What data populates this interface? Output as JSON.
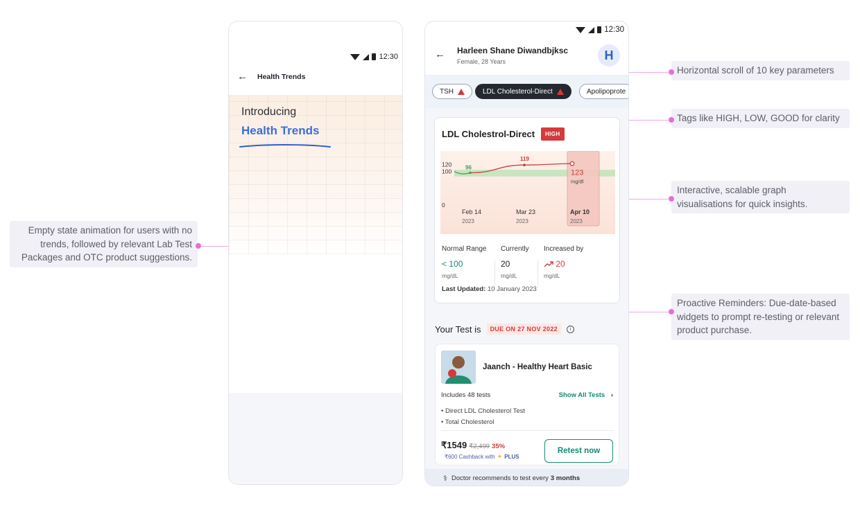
{
  "annotations": {
    "empty_state": "Empty state animation for users with no trends, followed by relevant Lab Test Packages and OTC product suggestions.",
    "horizontal_scroll": "Horizontal scroll of 10 key parameters",
    "tags": "Tags like HIGH, LOW, GOOD for clarity",
    "graph": "Interactive, scalable graph visualisations for quick insights.",
    "reminders": "Proactive Reminders: Due-date-based widgets to prompt re-testing or relevant product purchase."
  },
  "phone1": {
    "time": "12:30",
    "header_title": "Health Trends",
    "intro": "Introducing",
    "hero_title": "Health Trends"
  },
  "phone2": {
    "time": "12:30",
    "patient_name": "Harleen Shane Diwandbjksc",
    "patient_sub": "Female, 28 Years",
    "avatar_letter": "H",
    "chips": [
      "TSH",
      "LDL Cholesterol-Direct",
      "Apolipoprote"
    ],
    "card": {
      "title": "LDL Cholestrol-Direct",
      "badge": "HIGH",
      "normal_label": "Normal Range",
      "normal_value": "< 100",
      "normal_unit": "mg/dL",
      "current_label": "Currently",
      "current_value": "20",
      "current_unit": "mg/dL",
      "increase_label": "Increased by",
      "increase_value": "20",
      "increase_unit": "mg/dL",
      "updated_label": "Last Updated:",
      "updated_value": "10 January 2023"
    },
    "your_test_label": "Your Test is",
    "due_label": "DUE ON 27 NOV 2022",
    "package": {
      "name": "Jaanch - Healthy Heart Basic",
      "includes": "Includes 48 tests",
      "show_all": "Show All Tests",
      "items": [
        "• Direct LDL Cholesterol Test",
        "• Total Cholesterol"
      ],
      "price": "₹1549",
      "old_price": "₹2,499",
      "discount": "35%",
      "cashback": "₹600 Cashback with",
      "plus": "PLUS",
      "button": "Retest now"
    },
    "doctor_note": "Doctor recommends to test every",
    "doctor_note_bold": "3 months"
  },
  "chart_data": {
    "type": "line",
    "categories": [
      "Feb 14",
      "Mar 23",
      "Apr 10"
    ],
    "category_years": [
      "2023",
      "2023",
      "2023"
    ],
    "values": [
      96,
      119,
      123
    ],
    "point_labels": [
      "96",
      "119",
      "123"
    ],
    "selected_unit": "mg/dl",
    "yticks": [
      0,
      100,
      120
    ],
    "normal_band": [
      85,
      105
    ],
    "colors": {
      "line": "#c2413b",
      "band": "#bfe3b8",
      "first_point": "#3f9e5a"
    }
  }
}
